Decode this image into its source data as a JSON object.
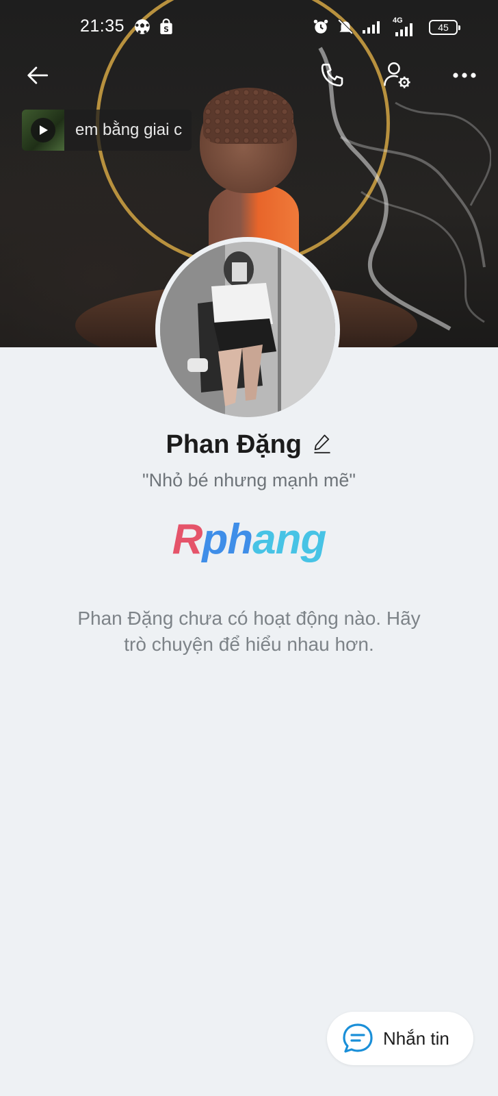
{
  "status_bar": {
    "time": "21:35",
    "network": "4G",
    "battery": "45"
  },
  "header": {
    "back_icon": "arrow-left-icon",
    "call_icon": "phone-icon",
    "settings_icon": "user-settings-icon",
    "more_icon": "more-horizontal-icon"
  },
  "music": {
    "title": "em bằng giai c"
  },
  "profile": {
    "name": "Phan Đặng",
    "bio": "\"Nhỏ bé nhưng mạnh mẽ\"",
    "watermark": "Rphang"
  },
  "empty_state": {
    "line1": "Phan Đặng chưa có hoạt động nào. Hãy",
    "line2": "trò chuyện để hiểu nhau hơn."
  },
  "message_button": {
    "label": "Nhắn tin"
  },
  "colors": {
    "background": "#eef1f4",
    "accent": "#1a8fd8"
  }
}
